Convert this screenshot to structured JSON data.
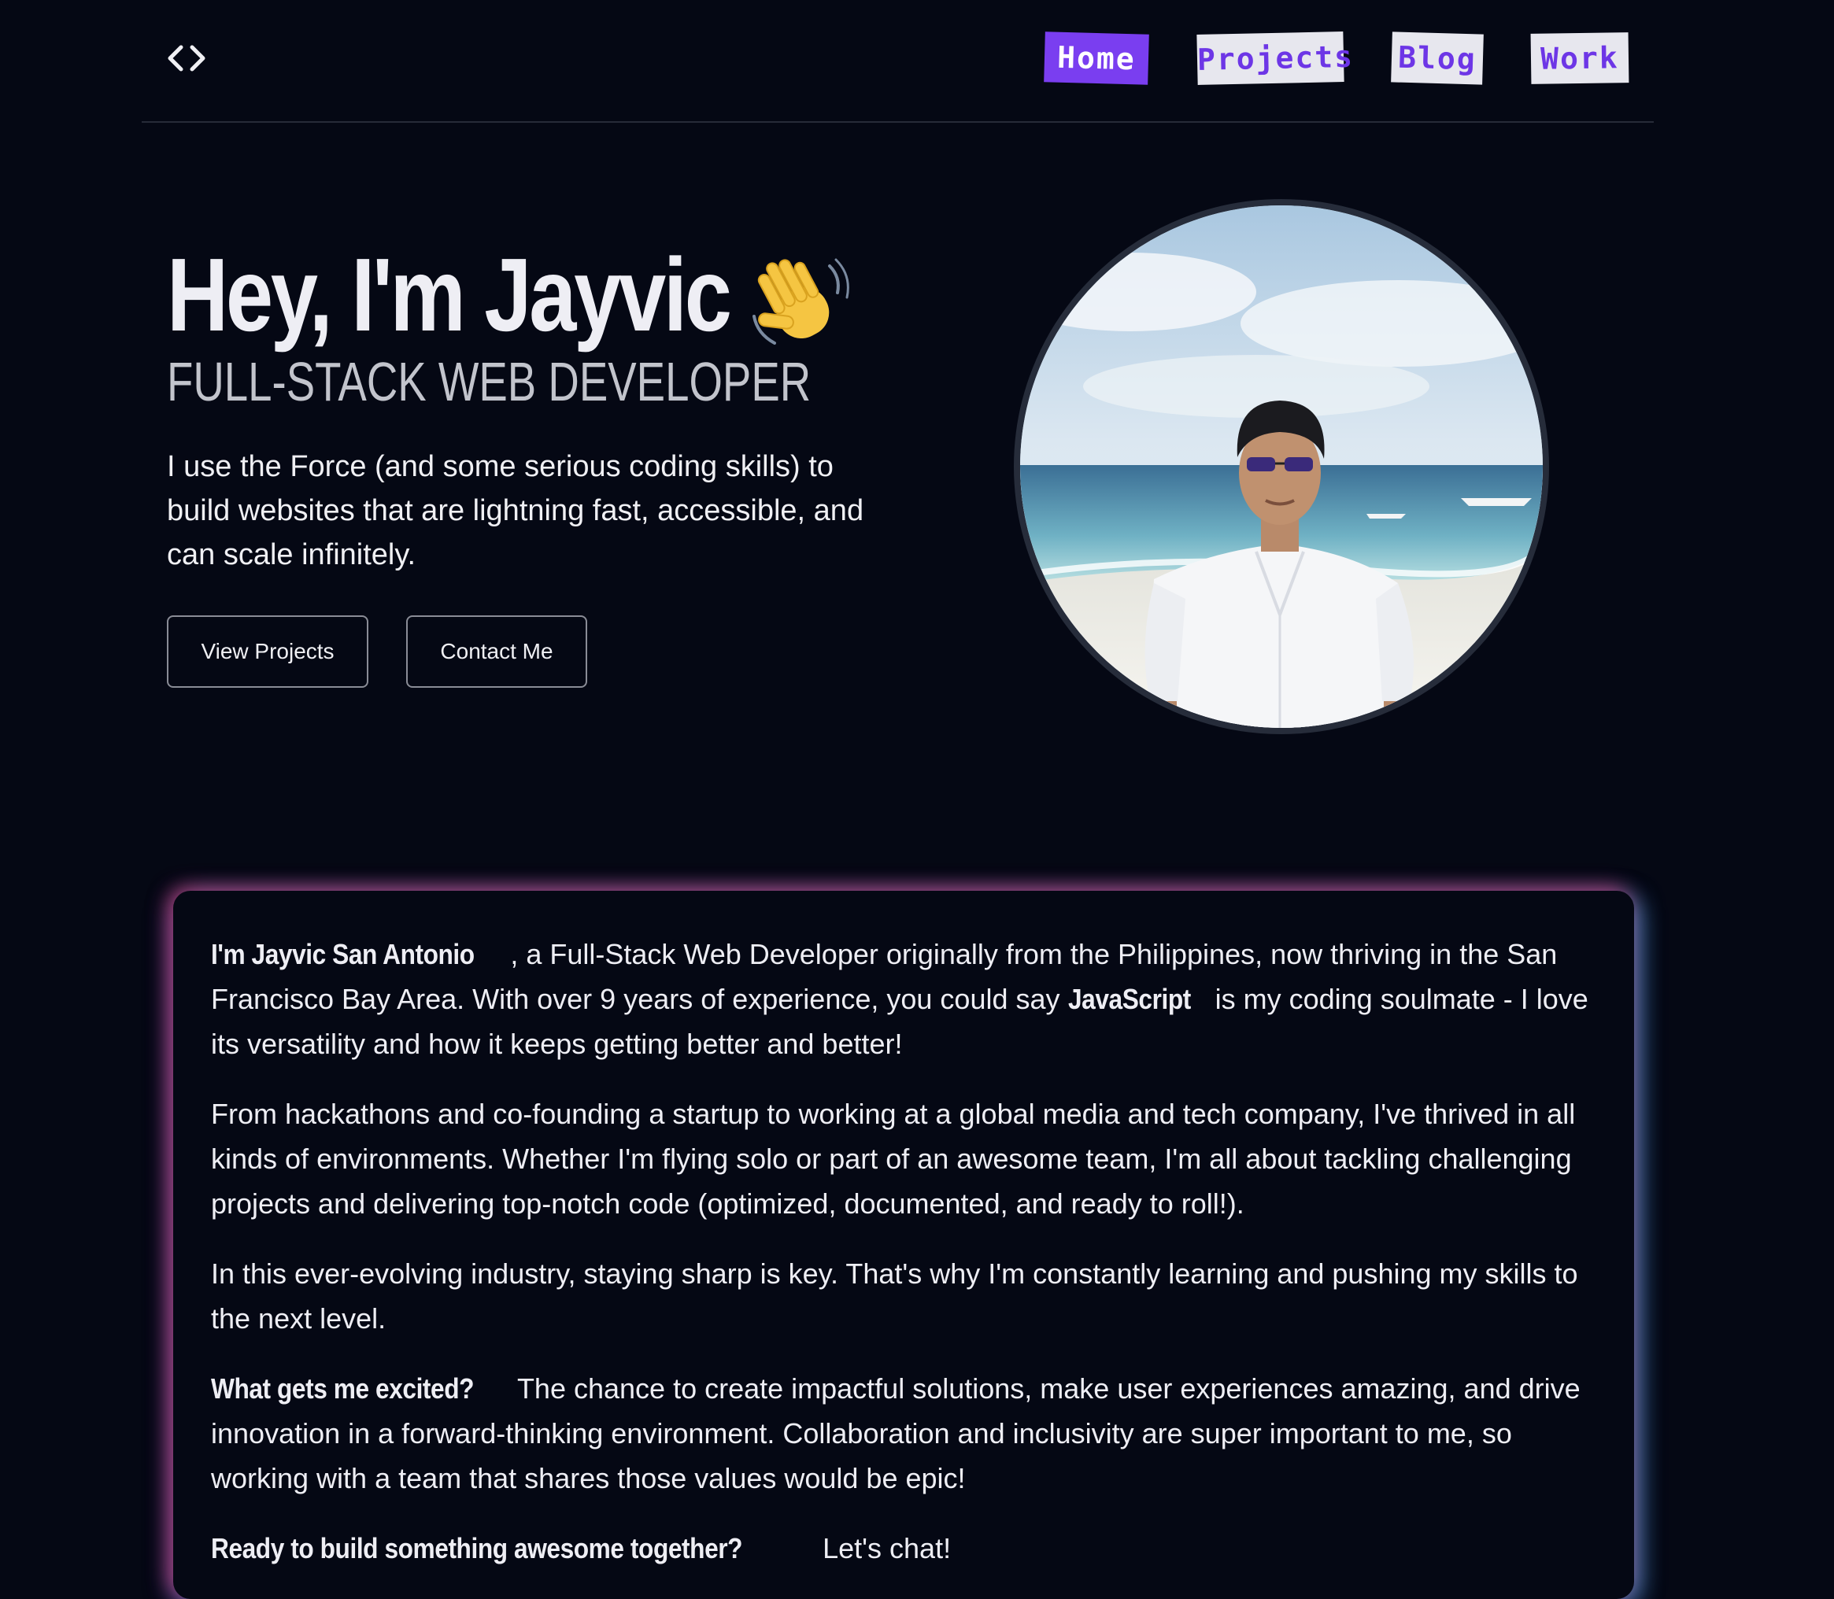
{
  "nav": {
    "items": [
      {
        "label": "Home"
      },
      {
        "label": "Projects"
      },
      {
        "label": "Blog"
      },
      {
        "label": "Work"
      }
    ]
  },
  "hero": {
    "title": "Hey, I'm Jayvic",
    "subtitle": "FULL-STACK WEB DEVELOPER",
    "description": "I use the Force (and some serious coding skills) to build websites that are lightning fast, accessible, and can scale infinitely.",
    "buttons": {
      "projects": "View Projects",
      "contact": "Contact Me"
    }
  },
  "about": {
    "p1": {
      "strong1": "I'm Jayvic San Antonio",
      "text1": ", a Full-Stack Web Developer originally from the Philippines, now thriving in the San Francisco Bay Area. With over 9 years of experience, you could say ",
      "strong2": "JavaScript",
      "text2": " is my coding soulmate - I love its versatility and how it keeps getting better and better!"
    },
    "p2": "From hackathons and co-founding a startup to working at a global media and tech company, I've thrived in all kinds of environments. Whether I'm flying solo or part of an awesome team, I'm all about tackling challenging projects and delivering top-notch code (optimized, documented, and ready to roll!).",
    "p3": "In this ever-evolving industry, staying sharp is key. That's why I'm constantly learning and pushing my skills to the next level.",
    "p4": {
      "strong": "What gets me excited?",
      "text": " The chance to create impactful solutions, make user experiences amazing, and drive innovation in a forward-thinking environment. Collaboration and inclusivity are super important to me, so working with a team that shares those values would be epic!"
    },
    "p5": {
      "strong": "Ready to build something awesome together?",
      "text": " Let's chat!"
    }
  },
  "icons": {
    "logo": "code-brackets-icon",
    "wave": "waving-hand-icon"
  },
  "colors": {
    "background": "#050814",
    "accent": "#7a3ef0",
    "nav_text": "#6d36e6"
  }
}
